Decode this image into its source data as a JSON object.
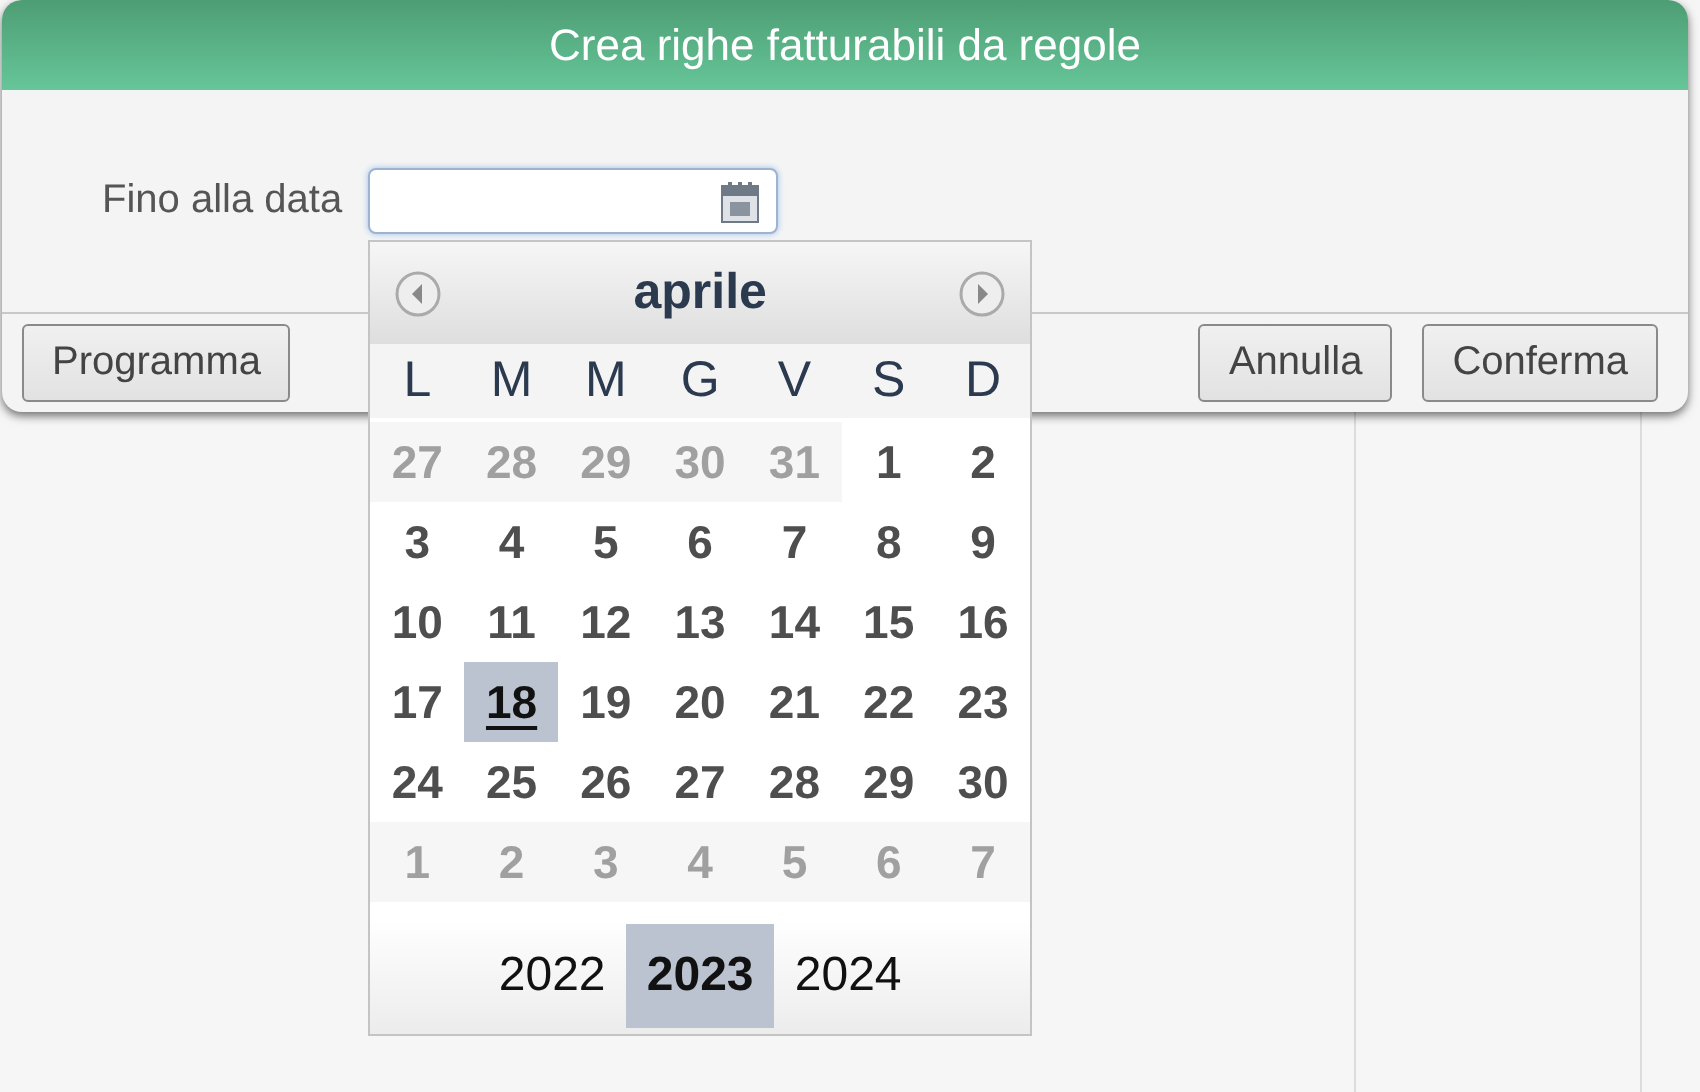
{
  "dialog": {
    "title": "Crea righe fatturabili da regole"
  },
  "field": {
    "label": "Fino alla data"
  },
  "calendar": {
    "month": "aprile",
    "weekdays": [
      "L",
      "M",
      "M",
      "G",
      "V",
      "S",
      "D"
    ],
    "weeks": [
      [
        {
          "day": "27",
          "outside": true,
          "selected": false
        },
        {
          "day": "28",
          "outside": true,
          "selected": false
        },
        {
          "day": "29",
          "outside": true,
          "selected": false
        },
        {
          "day": "30",
          "outside": true,
          "selected": false
        },
        {
          "day": "31",
          "outside": true,
          "selected": false
        },
        {
          "day": "1",
          "outside": false,
          "selected": false
        },
        {
          "day": "2",
          "outside": false,
          "selected": false
        }
      ],
      [
        {
          "day": "3",
          "outside": false,
          "selected": false
        },
        {
          "day": "4",
          "outside": false,
          "selected": false
        },
        {
          "day": "5",
          "outside": false,
          "selected": false
        },
        {
          "day": "6",
          "outside": false,
          "selected": false
        },
        {
          "day": "7",
          "outside": false,
          "selected": false
        },
        {
          "day": "8",
          "outside": false,
          "selected": false
        },
        {
          "day": "9",
          "outside": false,
          "selected": false
        }
      ],
      [
        {
          "day": "10",
          "outside": false,
          "selected": false
        },
        {
          "day": "11",
          "outside": false,
          "selected": false
        },
        {
          "day": "12",
          "outside": false,
          "selected": false
        },
        {
          "day": "13",
          "outside": false,
          "selected": false
        },
        {
          "day": "14",
          "outside": false,
          "selected": false
        },
        {
          "day": "15",
          "outside": false,
          "selected": false
        },
        {
          "day": "16",
          "outside": false,
          "selected": false
        }
      ],
      [
        {
          "day": "17",
          "outside": false,
          "selected": false
        },
        {
          "day": "18",
          "outside": false,
          "selected": true
        },
        {
          "day": "19",
          "outside": false,
          "selected": false
        },
        {
          "day": "20",
          "outside": false,
          "selected": false
        },
        {
          "day": "21",
          "outside": false,
          "selected": false
        },
        {
          "day": "22",
          "outside": false,
          "selected": false
        },
        {
          "day": "23",
          "outside": false,
          "selected": false
        }
      ],
      [
        {
          "day": "24",
          "outside": false,
          "selected": false
        },
        {
          "day": "25",
          "outside": false,
          "selected": false
        },
        {
          "day": "26",
          "outside": false,
          "selected": false
        },
        {
          "day": "27",
          "outside": false,
          "selected": false
        },
        {
          "day": "28",
          "outside": false,
          "selected": false
        },
        {
          "day": "29",
          "outside": false,
          "selected": false
        },
        {
          "day": "30",
          "outside": false,
          "selected": false
        }
      ],
      [
        {
          "day": "1",
          "outside": true,
          "selected": false
        },
        {
          "day": "2",
          "outside": true,
          "selected": false
        },
        {
          "day": "3",
          "outside": true,
          "selected": false
        },
        {
          "day": "4",
          "outside": true,
          "selected": false
        },
        {
          "day": "5",
          "outside": true,
          "selected": false
        },
        {
          "day": "6",
          "outside": true,
          "selected": false
        },
        {
          "day": "7",
          "outside": true,
          "selected": false
        }
      ]
    ],
    "years": [
      {
        "label": "2022",
        "selected": false
      },
      {
        "label": "2023",
        "selected": true
      },
      {
        "label": "2024",
        "selected": false
      }
    ]
  },
  "buttons_left": [
    "Programma"
  ],
  "buttons_right": [
    "Annulla",
    "Conferma"
  ]
}
